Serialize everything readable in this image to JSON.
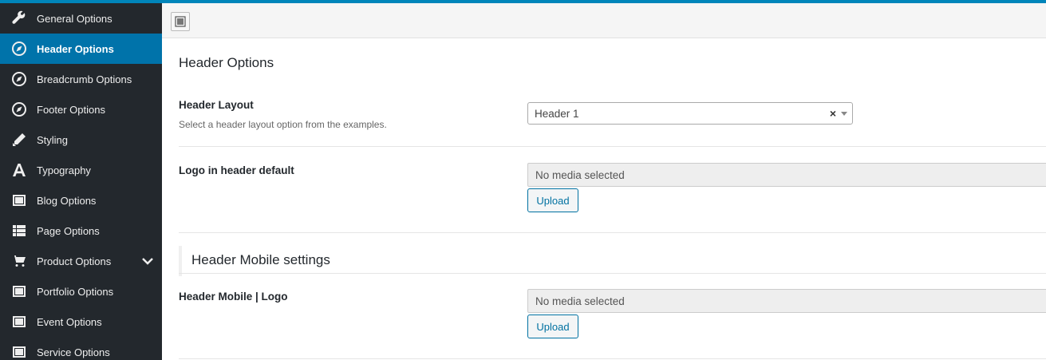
{
  "sidebar": {
    "items": [
      {
        "label": "General Options",
        "icon": "wrench-icon"
      },
      {
        "label": "Header Options",
        "icon": "compass-icon",
        "active": true
      },
      {
        "label": "Breadcrumb Options",
        "icon": "compass-icon"
      },
      {
        "label": "Footer Options",
        "icon": "compass-icon"
      },
      {
        "label": "Styling",
        "icon": "pencil-icon"
      },
      {
        "label": "Typography",
        "icon": "typography-icon"
      },
      {
        "label": "Blog Options",
        "icon": "window-icon"
      },
      {
        "label": "Page Options",
        "icon": "list-icon"
      },
      {
        "label": "Product Options",
        "icon": "cart-icon",
        "has_submenu": true
      },
      {
        "label": "Portfolio Options",
        "icon": "window-icon"
      },
      {
        "label": "Event Options",
        "icon": "window-icon"
      },
      {
        "label": "Service Options",
        "icon": "window-icon"
      }
    ]
  },
  "main": {
    "section_title": "Header Options",
    "header_layout": {
      "label": "Header Layout",
      "description": "Select a header layout option from the examples.",
      "value": "Header 1",
      "clear_symbol": "×"
    },
    "logo_default": {
      "label": "Logo in header default",
      "media_value": "No media selected",
      "upload_label": "Upload"
    },
    "mobile_section": {
      "title": "Header Mobile settings"
    },
    "mobile_logo": {
      "label": "Header Mobile | Logo",
      "media_value": "No media selected",
      "upload_label": "Upload"
    }
  },
  "colors": {
    "accent": "#0073aa",
    "sidebar_bg": "#23282d",
    "topbar": "#0085ba"
  }
}
